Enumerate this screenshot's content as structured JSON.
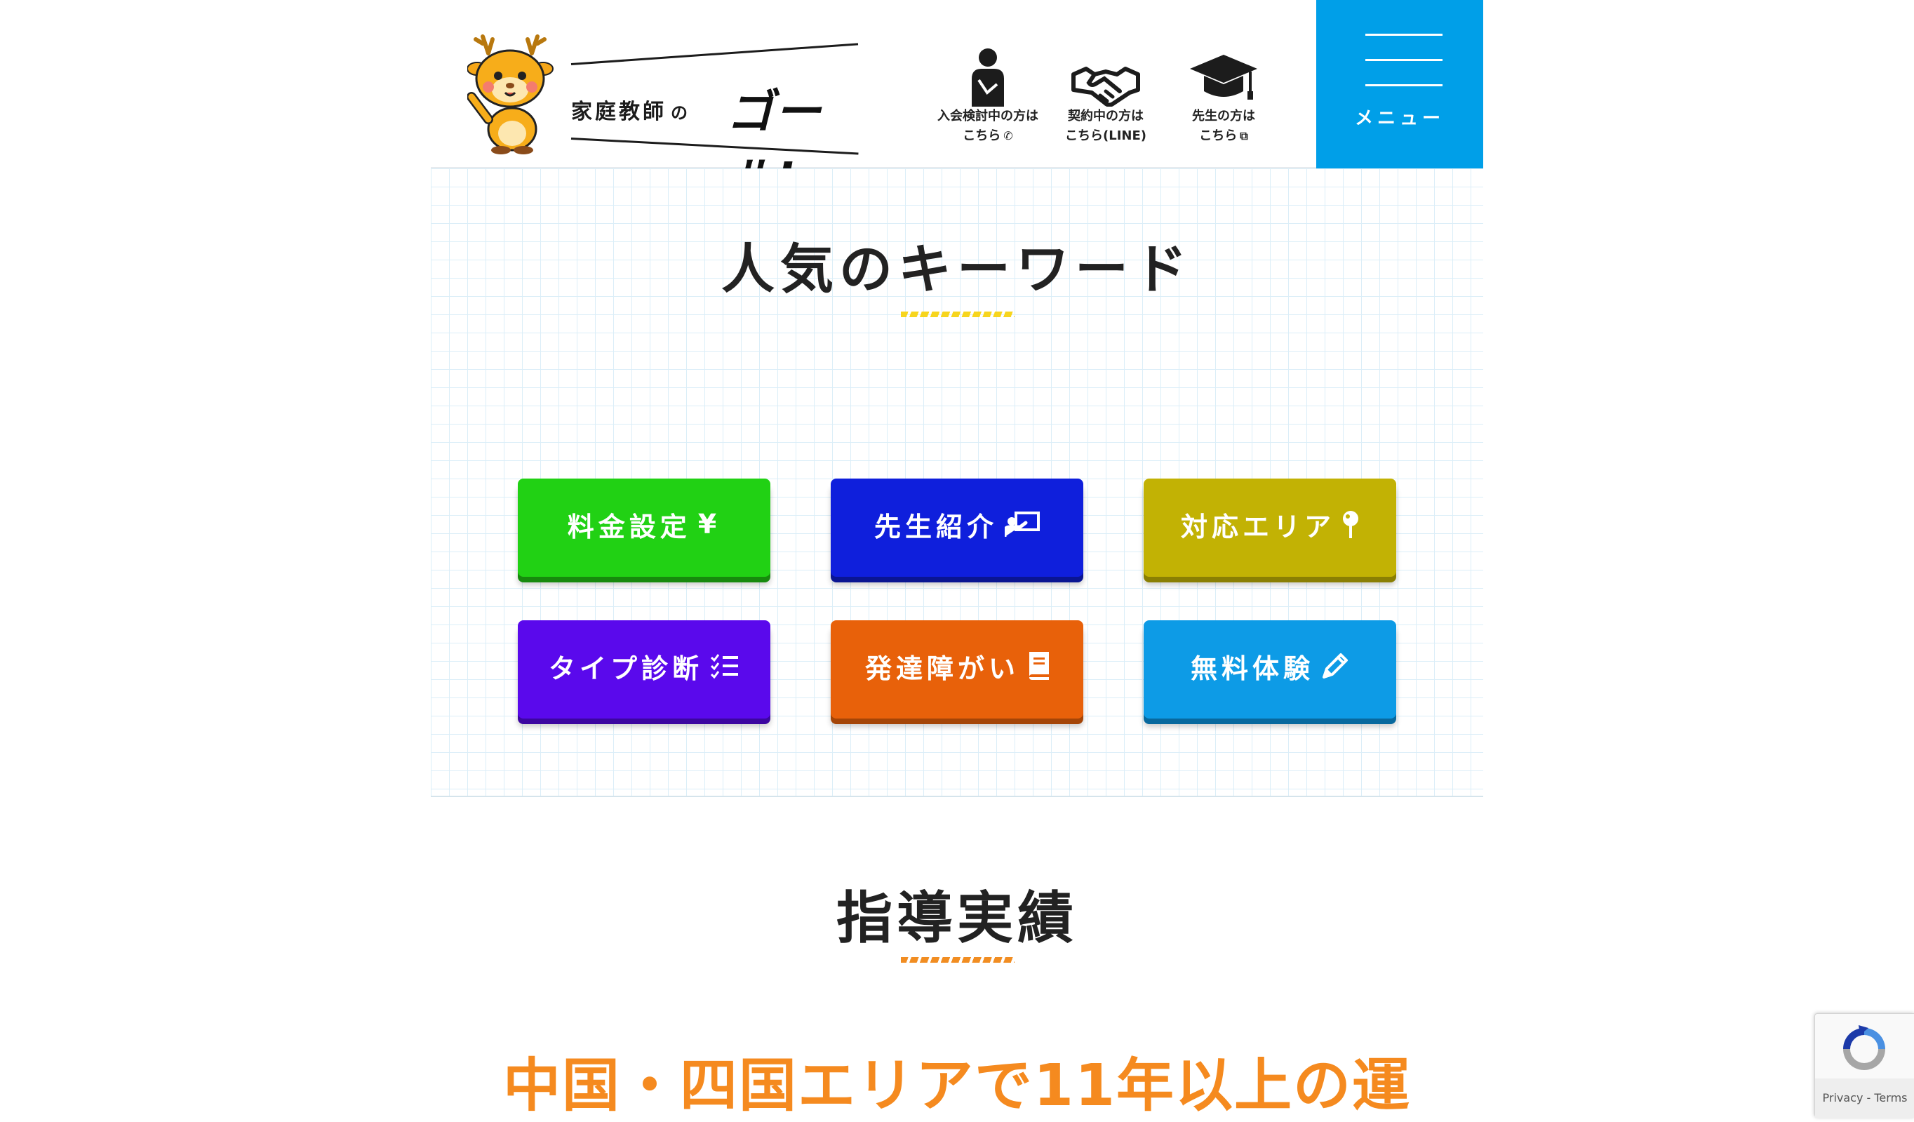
{
  "header": {
    "logo": {
      "small_text": "家庭教師",
      "small_no": "の",
      "big_text": "ゴール!"
    },
    "links": [
      {
        "line1": "入会検討中の方は",
        "line2": "こちら",
        "suffix_icon": "phone-icon",
        "icon": "person-icon"
      },
      {
        "line1": "契約中の方は",
        "line2": "こちら(LINE)",
        "suffix_icon": "",
        "icon": "handshake-icon"
      },
      {
        "line1": "先生の方は",
        "line2": "こちら",
        "suffix_icon": "external-link-icon",
        "icon": "graduation-cap-icon"
      }
    ],
    "menu_label": "メニュー",
    "menu_color": "#009fe8"
  },
  "keywords": {
    "title": "人気のキーワード",
    "buttons": [
      {
        "label": "料金設定",
        "icon_text": "¥",
        "icon": "yen-icon",
        "color": "#21d114",
        "shadow": "#178a0d"
      },
      {
        "label": "先生紹介",
        "icon_text": "",
        "icon": "teacher-board-icon",
        "color": "#0f1fdc",
        "shadow": "#0a1592"
      },
      {
        "label": "対応エリア",
        "icon_text": "",
        "icon": "map-pin-icon",
        "color": "#c2b204",
        "shadow": "#8a7f03"
      },
      {
        "label": "タイプ診断",
        "icon_text": "",
        "icon": "checklist-icon",
        "color": "#5a09ec",
        "shadow": "#3c06a0"
      },
      {
        "label": "発達障がい",
        "icon_text": "",
        "icon": "book-icon",
        "color": "#e8610a",
        "shadow": "#a54507"
      },
      {
        "label": "無料体験",
        "icon_text": "",
        "icon": "pencil-icon",
        "color": "#0d9be6",
        "shadow": "#08699e"
      }
    ]
  },
  "achievements": {
    "title": "指導実績",
    "lead": "中国・四国エリアで11年以上の運"
  },
  "recaptcha": {
    "links": "Privacy - Terms"
  }
}
